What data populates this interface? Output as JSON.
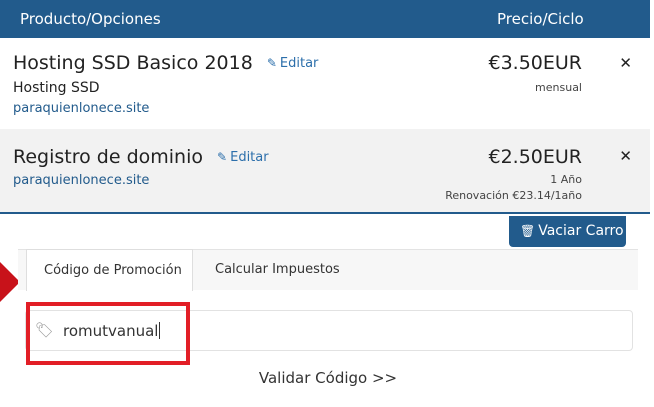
{
  "header": {
    "product_label": "Producto/Opciones",
    "price_label": "Precio/Ciclo"
  },
  "items": [
    {
      "name": "Hosting SSD Basico 2018",
      "edit_label": "Editar",
      "group": "Hosting SSD",
      "domain": "paraquienlonece.site",
      "price": "€3.50EUR",
      "cycle": "mensual",
      "renewal": ""
    },
    {
      "name": "Registro de dominio",
      "edit_label": "Editar",
      "group": "",
      "domain": "paraquienlonece.site",
      "price": "€2.50EUR",
      "cycle": "1 Año",
      "renewal": "Renovación €23.14/1año"
    }
  ],
  "empty_cart_label": "Vaciar Carro",
  "tabs": [
    {
      "label": "Código de Promoción",
      "active": true
    },
    {
      "label": "Calcular Impuestos",
      "active": false
    }
  ],
  "promo": {
    "value": "romutvanual",
    "validate_label": "Validar Código >>"
  },
  "icons": {
    "edit": "pencil-icon",
    "remove": "close-icon",
    "empty_cart": "trash-icon",
    "promo": "tag-icon"
  },
  "colors": {
    "primary": "#225b8c",
    "link": "#2c6fab",
    "highlight": "#e21e26",
    "row_alt": "#f2f2f2"
  }
}
